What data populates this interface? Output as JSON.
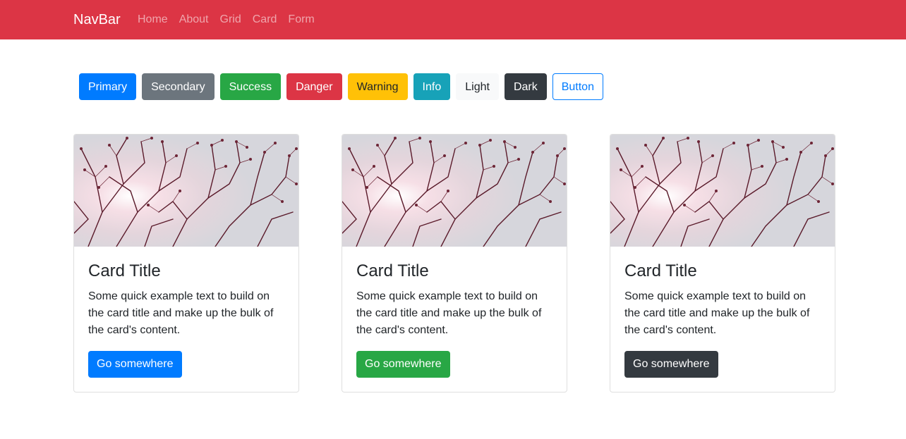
{
  "navbar": {
    "brand": "NavBar",
    "links": [
      "Home",
      "About",
      "Grid",
      "Card",
      "Form"
    ],
    "color": "#dc3545"
  },
  "buttons": [
    {
      "label": "Primary",
      "variant": "primary"
    },
    {
      "label": "Secondary",
      "variant": "secondary"
    },
    {
      "label": "Success",
      "variant": "success"
    },
    {
      "label": "Danger",
      "variant": "danger"
    },
    {
      "label": "Warning",
      "variant": "warning"
    },
    {
      "label": "Info",
      "variant": "info"
    },
    {
      "label": "Light",
      "variant": "light"
    },
    {
      "label": "Dark",
      "variant": "dark"
    },
    {
      "label": "Button",
      "variant": "outline-primary"
    }
  ],
  "cards": [
    {
      "title": "Card Title",
      "text": "Some quick example text to build on the card title and make up the bulk of the card's content.",
      "button": "Go somewhere",
      "button_color": "#007bff"
    },
    {
      "title": "Card Title",
      "text": "Some quick example text to build on the card title and make up the bulk of the card's content.",
      "button": "Go somewhere",
      "button_color": "#28a745"
    },
    {
      "title": "Card Title",
      "text": "Some quick example text to build on the card title and make up the bulk of the card's content.",
      "button": "Go somewhere",
      "button_color": "#343a40"
    }
  ]
}
